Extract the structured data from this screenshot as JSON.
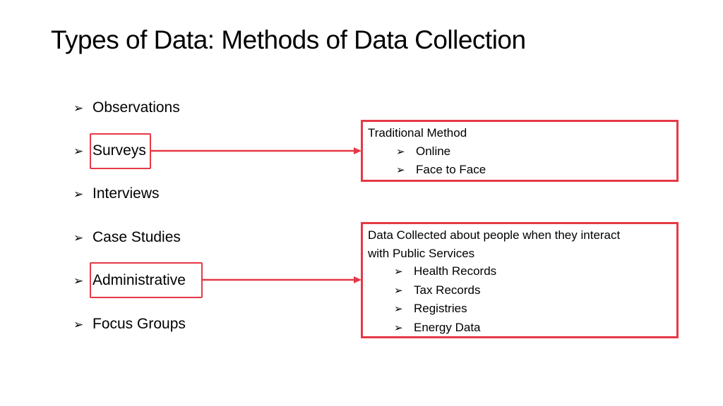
{
  "slide": {
    "title": "Types of Data: Methods of Data Collection",
    "accent_color": "#e63946",
    "bullet_icon": "➢",
    "methods": [
      {
        "label": "Observations"
      },
      {
        "label": "Surveys"
      },
      {
        "label": "Interviews"
      },
      {
        "label": "Case Studies"
      },
      {
        "label": "Administrative"
      },
      {
        "label": "Focus Groups"
      }
    ],
    "surveys_box": {
      "heading": "Traditional Method",
      "items": [
        "Online",
        "Face to Face"
      ]
    },
    "administrative_box": {
      "heading_line1": "Data Collected about people when they interact",
      "heading_line2": "with Public Services",
      "items": [
        "Health Records",
        "Tax Records",
        "Registries",
        "Energy Data"
      ]
    }
  }
}
